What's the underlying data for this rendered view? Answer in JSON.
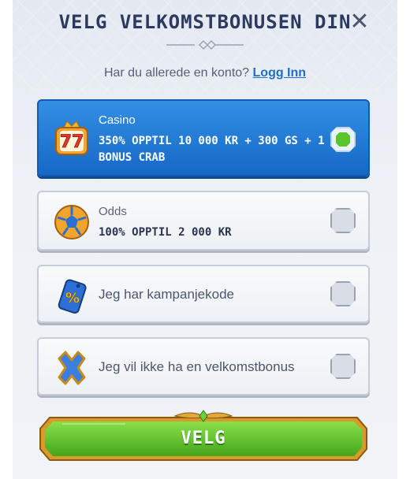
{
  "header": {
    "title": "VELG VELKOMSTBONUSEN DIN",
    "close_icon": "close-icon"
  },
  "login": {
    "prompt": "Har du allerede en konto?",
    "link": "Logg Inn"
  },
  "options": [
    {
      "label": "Casino",
      "offer": "350% OPPTIL 10 000 KR + 300 GS + 1 BONUS CRAB",
      "icon": "slot-seven-icon",
      "selected": true
    },
    {
      "label": "Odds",
      "offer": "100% OPPTIL 2 000 KR",
      "icon": "football-icon",
      "selected": false
    },
    {
      "text": "Jeg har kampanjekode",
      "icon": "percent-tag-icon",
      "selected": false
    },
    {
      "text": "Jeg vil ikke ha en velkomstbonus",
      "icon": "x-mark-icon",
      "selected": false
    }
  ],
  "cta": {
    "label": "VELG"
  },
  "colors": {
    "selected_card": "#1f7ad6",
    "cta_green": "#5fc32a",
    "check_green": "#5bc42a",
    "title": "#2b3a5e",
    "link": "#1f6fc6"
  }
}
